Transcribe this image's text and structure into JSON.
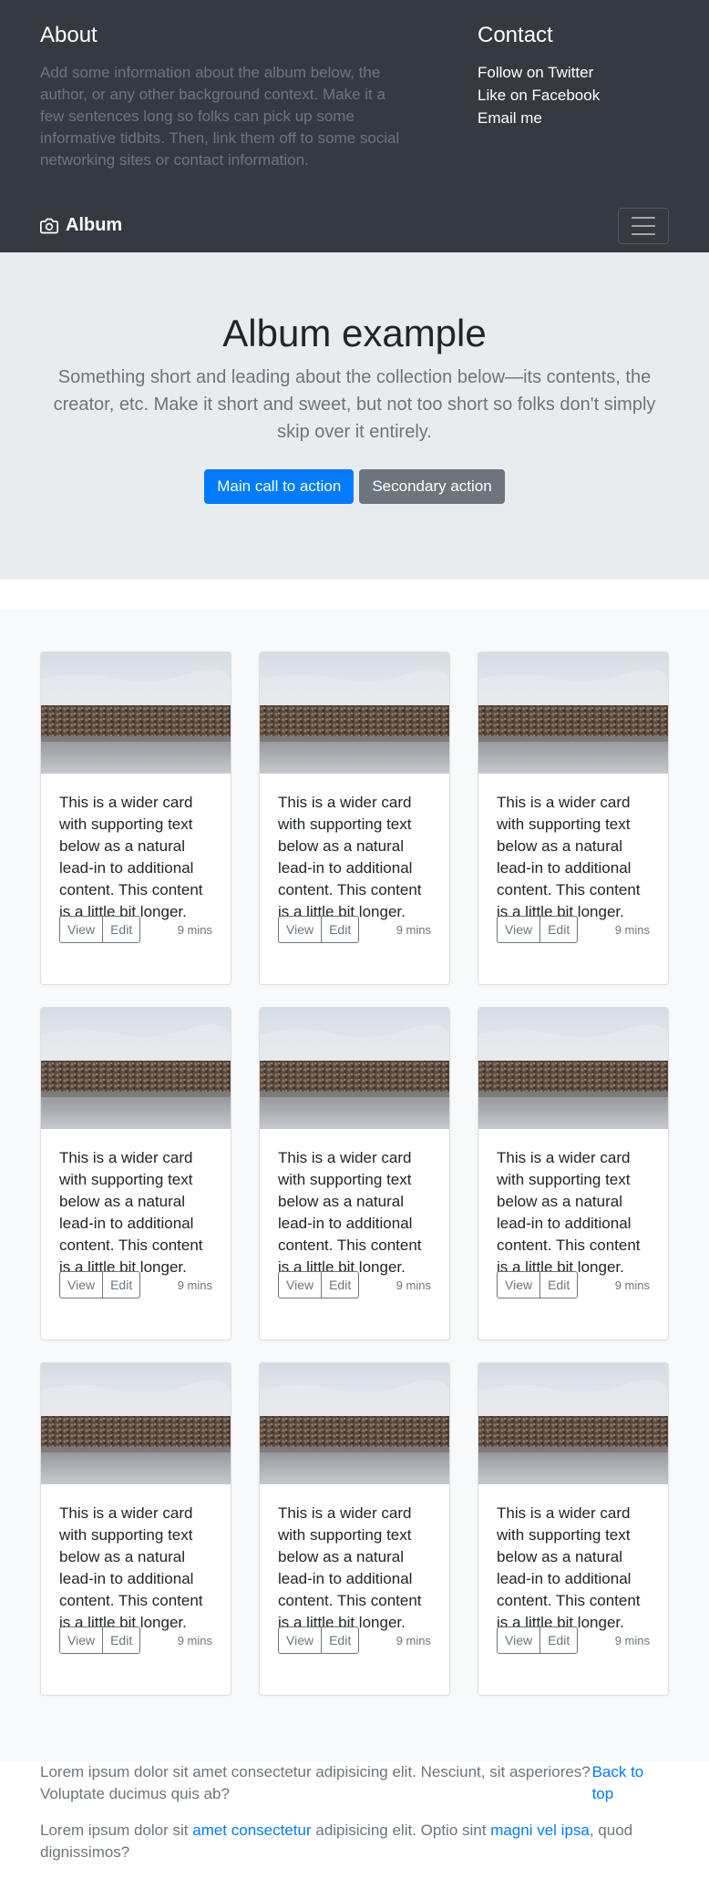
{
  "header": {
    "about": {
      "title": "About",
      "text": "Add some information about the album below, the author, or any other background context. Make it a few sentences long so folks can pick up some informative tidbits. Then, link them off to some social networking sites or contact information."
    },
    "contact": {
      "title": "Contact",
      "links": [
        "Follow on Twitter",
        "Like on Facebook",
        "Email me"
      ]
    },
    "brand": {
      "label": "Album",
      "icon": "camera-icon"
    },
    "toggler_icon": "hamburger-menu-icon"
  },
  "jumbotron": {
    "title": "Album example",
    "lead": "Something short and leading about the collection below—its contents, the creator, etc. Make it short and sweet, but not too short so folks don't simply skip over it entirely.",
    "primary_button": "Main call to action",
    "secondary_button": "Secondary action"
  },
  "album": {
    "cards": [
      {
        "text": "This is a wider card with supporting text below as a natural lead-in to additional content. This content is a little bit longer.",
        "view": "View",
        "edit": "Edit",
        "time": "9 mins"
      },
      {
        "text": "This is a wider card with supporting text below as a natural lead-in to additional content. This content is a little bit longer.",
        "view": "View",
        "edit": "Edit",
        "time": "9 mins"
      },
      {
        "text": "This is a wider card with supporting text below as a natural lead-in to additional content. This content is a little bit longer.",
        "view": "View",
        "edit": "Edit",
        "time": "9 mins"
      },
      {
        "text": "This is a wider card with supporting text below as a natural lead-in to additional content. This content is a little bit longer.",
        "view": "View",
        "edit": "Edit",
        "time": "9 mins"
      },
      {
        "text": "This is a wider card with supporting text below as a natural lead-in to additional content. This content is a little bit longer.",
        "view": "View",
        "edit": "Edit",
        "time": "9 mins"
      },
      {
        "text": "This is a wider card with supporting text below as a natural lead-in to additional content. This content is a little bit longer.",
        "view": "View",
        "edit": "Edit",
        "time": "9 mins"
      },
      {
        "text": "This is a wider card with supporting text below as a natural lead-in to additional content. This content is a little bit longer.",
        "view": "View",
        "edit": "Edit",
        "time": "9 mins"
      },
      {
        "text": "This is a wider card with supporting text below as a natural lead-in to additional content. This content is a little bit longer.",
        "view": "View",
        "edit": "Edit",
        "time": "9 mins"
      },
      {
        "text": "This is a wider card with supporting text below as a natural lead-in to additional content. This content is a little bit longer.",
        "view": "View",
        "edit": "Edit",
        "time": "9 mins"
      }
    ]
  },
  "footer": {
    "text1": "Lorem ipsum dolor sit amet consectetur adipisicing elit. Nesciunt, sit asperiores? Voluptate ducimus quis ab?",
    "back_to_top": "Back to top",
    "text2_part1": "Lorem ipsum dolor sit ",
    "text2_link1": "amet consectetur",
    "text2_part2": " adipisicing elit. Optio sint ",
    "text2_link2": "magni vel ipsa",
    "text2_part3": ", quod dignissimos?"
  },
  "colors": {
    "header_bg": "#343a40",
    "jumbotron_bg": "#e9ecef",
    "album_bg": "#f8f9fa",
    "primary": "#007bff",
    "secondary": "#6c757d"
  }
}
